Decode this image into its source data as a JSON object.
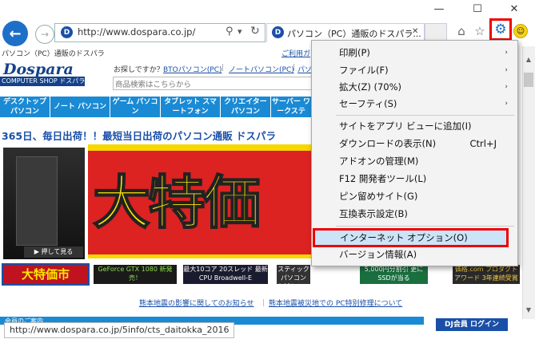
{
  "window": {
    "minimize": "—",
    "maximize": "☐",
    "close": "✕"
  },
  "toolbar": {
    "address": "http://www.dospara.co.jp/",
    "search_glyph": "⚲",
    "dropdown_glyph": "▾",
    "refresh_glyph": "↻",
    "tab_title": "パソコン（PC）通販のドスパラ...",
    "tab_close": "✕",
    "home_glyph": "⌂",
    "star_glyph": "☆",
    "gear_glyph": "⚙",
    "back_glyph": "←",
    "forward_glyph": "→",
    "favicon_letter": "D"
  },
  "page": {
    "site_caption": "パソコン（PC）通販のドスパラ",
    "logo_main": "Dospara",
    "logo_sub": "COMPUTER SHOP ドスパラ",
    "search_prompt": "お探しですか？",
    "links": [
      "BTOパソコン(PC)",
      "ノートパソコン(PC)",
      "パソコ"
    ],
    "corner_link": "ご利用ガ",
    "search_placeholder": "商品検索はこちらから",
    "nav": [
      "デスクトップ パソコン",
      "ノート パソコン",
      "ゲーム パソコン",
      "タブレット スマートフォン",
      "クリエイター パソコン",
      "サーバー ワークステ"
    ],
    "headline": "365日、毎日出荷！！最短当日出荷のパソコン通販 ドスパラ",
    "banner_text": "大特価",
    "oshi": "▶ 押して見る",
    "banners": [
      "大特価市",
      "GeForce GTX 1080 新発売！",
      "最大10コア 20スレッド 最新CPU Broadwell-E",
      "スティックパソコン お試しキャンペーン!",
      "5,000円分割引 更にSSDが当る",
      "価格.com プロダクトアワード 3年連続受賞"
    ],
    "notice_1": "熊本地震の影響に関してのお知らせ",
    "notice_sep": "｜",
    "notice_2": "熊本地震被災地での PC特別修理について",
    "bottom_left": "会員のご案内",
    "bottom_right": "DJ会員 ログイン",
    "status_url": "http://www.dospara.co.jp/5info/cts_daitokka_2016"
  },
  "menu": {
    "items": [
      {
        "label": "印刷(P)",
        "shortcut": "",
        "submenu": true
      },
      {
        "label": "ファイル(F)",
        "shortcut": "",
        "submenu": true
      },
      {
        "label": "拡大(Z) (70%)",
        "shortcut": "",
        "submenu": true
      },
      {
        "label": "セーフティ(S)",
        "shortcut": "",
        "submenu": true
      },
      {
        "label": "サイトをアプリ ビューに追加(I)",
        "shortcut": "",
        "submenu": false
      },
      {
        "label": "ダウンロードの表示(N)",
        "shortcut": "Ctrl+J",
        "submenu": false
      },
      {
        "label": "アドオンの管理(M)",
        "shortcut": "",
        "submenu": false
      },
      {
        "label": "F12 開発者ツール(L)",
        "shortcut": "",
        "submenu": false
      },
      {
        "label": "ピン留めサイト(G)",
        "shortcut": "",
        "submenu": false
      },
      {
        "label": "互換表示設定(B)",
        "shortcut": "",
        "submenu": false
      },
      {
        "label": "インターネット オプション(O)",
        "shortcut": "",
        "submenu": false,
        "highlighted": true
      },
      {
        "label": "バージョン情報(A)",
        "shortcut": "",
        "submenu": false
      }
    ],
    "submenu_arrow": "›"
  },
  "colors": {
    "accent": "#1e6fc8",
    "highlight_border": "#e00000",
    "nav_tile": "#1a8ad4",
    "banner_yellow": "#f7d700",
    "banner_red": "#d22222"
  }
}
